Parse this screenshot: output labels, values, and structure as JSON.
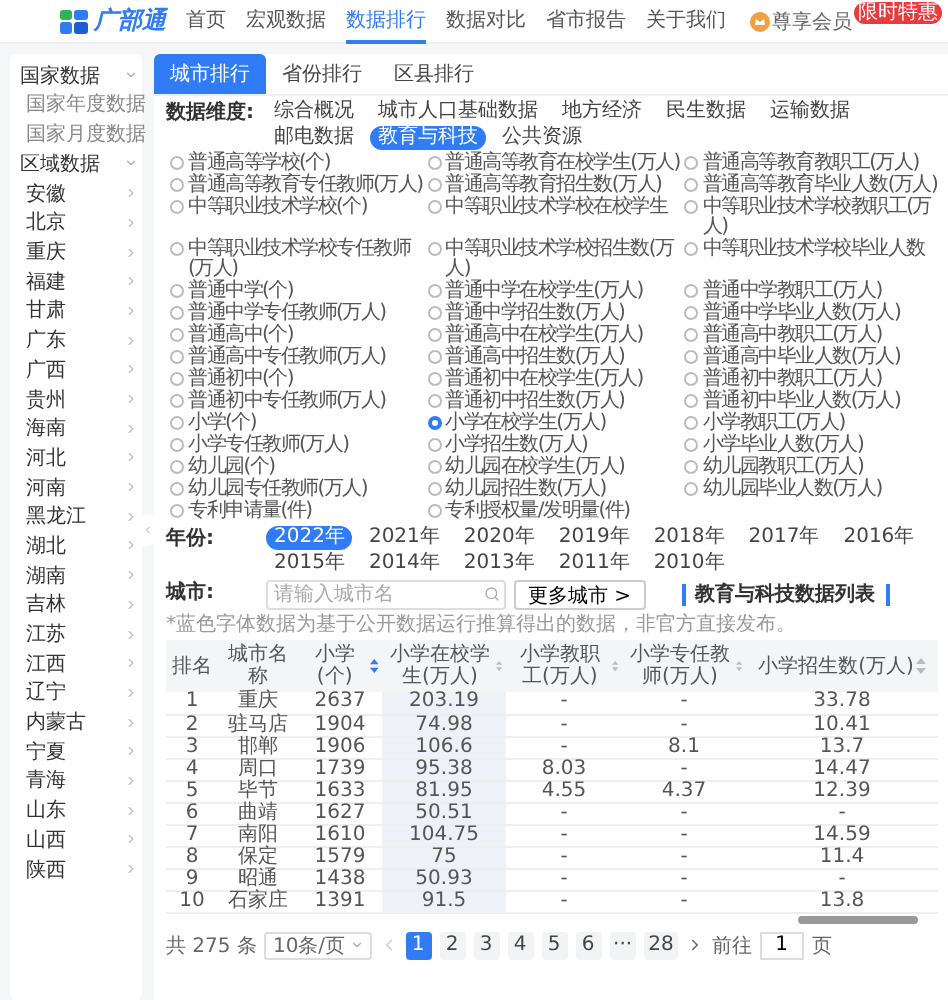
{
  "header": {
    "logo": "广部通",
    "nav": [
      {
        "label": "首页",
        "selected": false
      },
      {
        "label": "宏观数据",
        "selected": false
      },
      {
        "label": "数据排行",
        "selected": true
      },
      {
        "label": "数据对比",
        "selected": false
      },
      {
        "label": "省市报告",
        "selected": false
      },
      {
        "label": "关于我们",
        "selected": false
      }
    ],
    "member": "尊享会员",
    "badge": "限时特惠"
  },
  "sidebar": [
    {
      "label": "国家数据",
      "expanded": true,
      "children": [
        {
          "label": "国家年度数据"
        },
        {
          "label": "国家月度数据"
        }
      ]
    },
    {
      "label": "区域数据",
      "expanded": true,
      "children": [
        {
          "label": "安徽",
          "expanded": false
        },
        {
          "label": "北京",
          "expanded": false
        },
        {
          "label": "重庆",
          "expanded": false
        },
        {
          "label": "福建",
          "expanded": false
        },
        {
          "label": "甘肃",
          "expanded": false
        },
        {
          "label": "广东",
          "expanded": false
        },
        {
          "label": "广西",
          "expanded": false
        },
        {
          "label": "贵州",
          "expanded": false
        },
        {
          "label": "海南",
          "expanded": false
        },
        {
          "label": "河北",
          "expanded": false
        },
        {
          "label": "河南",
          "expanded": false
        },
        {
          "label": "黑龙江",
          "expanded": false
        },
        {
          "label": "湖北",
          "expanded": false
        },
        {
          "label": "湖南",
          "expanded": false
        },
        {
          "label": "吉林",
          "expanded": false
        },
        {
          "label": "江苏",
          "expanded": false
        },
        {
          "label": "江西",
          "expanded": false
        },
        {
          "label": "辽宁",
          "expanded": false
        },
        {
          "label": "内蒙古",
          "expanded": false
        },
        {
          "label": "宁夏",
          "expanded": false
        },
        {
          "label": "青海",
          "expanded": false
        },
        {
          "label": "山东",
          "expanded": false
        },
        {
          "label": "山西",
          "expanded": false
        },
        {
          "label": "陕西",
          "expanded": false
        }
      ]
    }
  ],
  "tabs": [
    {
      "label": "城市排行",
      "selected": true
    },
    {
      "label": "省份排行",
      "selected": false
    },
    {
      "label": "区县排行",
      "selected": false
    }
  ],
  "dimension": {
    "label": "数据维度:",
    "items": [
      {
        "label": "综合概况",
        "selected": false
      },
      {
        "label": "城市人口基础数据",
        "selected": false
      },
      {
        "label": "地方经济",
        "selected": false
      },
      {
        "label": "民生数据",
        "selected": false
      },
      {
        "label": "运输数据",
        "selected": false
      },
      {
        "label": "邮电数据",
        "selected": false
      },
      {
        "label": "教育与科技",
        "selected": true
      },
      {
        "label": "公共资源",
        "selected": false
      }
    ]
  },
  "indicators": [
    {
      "label": "普通高等学校(个)",
      "selected": false
    },
    {
      "label": "普通高等教育在校学生(万人)",
      "selected": false
    },
    {
      "label": "普通高等教育教职工(万人)",
      "selected": false
    },
    {
      "label": "普通高等教育专任教师(万人)",
      "selected": false
    },
    {
      "label": "普通高等教育招生数(万人)",
      "selected": false
    },
    {
      "label": "普通高等教育毕业人数(万人)",
      "selected": false
    },
    {
      "label": "中等职业技术学校(个)",
      "selected": false
    },
    {
      "label": "中等职业技术学校在校学生",
      "selected": false
    },
    {
      "label": "中等职业技术学校教职工(万人)",
      "selected": false
    },
    {
      "label": "中等职业技术学校专任教师(万人)",
      "selected": false
    },
    {
      "label": "中等职业技术学校招生数(万人)",
      "selected": false
    },
    {
      "label": "中等职业技术学校毕业人数",
      "selected": false
    },
    {
      "label": "普通中学(个)",
      "selected": false
    },
    {
      "label": "普通中学在校学生(万人)",
      "selected": false
    },
    {
      "label": "普通中学教职工(万人)",
      "selected": false
    },
    {
      "label": "普通中学专任教师(万人)",
      "selected": false
    },
    {
      "label": "普通中学招生数(万人)",
      "selected": false
    },
    {
      "label": "普通中学毕业人数(万人)",
      "selected": false
    },
    {
      "label": "普通高中(个)",
      "selected": false
    },
    {
      "label": "普通高中在校学生(万人)",
      "selected": false
    },
    {
      "label": "普通高中教职工(万人)",
      "selected": false
    },
    {
      "label": "普通高中专任教师(万人)",
      "selected": false
    },
    {
      "label": "普通高中招生数(万人)",
      "selected": false
    },
    {
      "label": "普通高中毕业人数(万人)",
      "selected": false
    },
    {
      "label": "普通初中(个)",
      "selected": false
    },
    {
      "label": "普通初中在校学生(万人)",
      "selected": false
    },
    {
      "label": "普通初中教职工(万人)",
      "selected": false
    },
    {
      "label": "普通初中专任教师(万人)",
      "selected": false
    },
    {
      "label": "普通初中招生数(万人)",
      "selected": false
    },
    {
      "label": "普通初中毕业人数(万人)",
      "selected": false
    },
    {
      "label": "小学(个)",
      "selected": false
    },
    {
      "label": "小学在校学生(万人)",
      "selected": true
    },
    {
      "label": "小学教职工(万人)",
      "selected": false
    },
    {
      "label": "小学专任教师(万人)",
      "selected": false
    },
    {
      "label": "小学招生数(万人)",
      "selected": false
    },
    {
      "label": "小学毕业人数(万人)",
      "selected": false
    },
    {
      "label": "幼儿园(个)",
      "selected": false
    },
    {
      "label": "幼儿园在校学生(万人)",
      "selected": false
    },
    {
      "label": "幼儿园教职工(万人)",
      "selected": false
    },
    {
      "label": "幼儿园专任教师(万人)",
      "selected": false
    },
    {
      "label": "幼儿园招生数(万人)",
      "selected": false
    },
    {
      "label": "幼儿园毕业人数(万人)",
      "selected": false
    },
    {
      "label": "专利申请量(件)",
      "selected": false
    },
    {
      "label": "专利授权量/发明量(件)",
      "selected": false
    }
  ],
  "year": {
    "label": "年份:",
    "items": [
      {
        "label": "2022年",
        "selected": true
      },
      {
        "label": "2021年",
        "selected": false
      },
      {
        "label": "2020年",
        "selected": false
      },
      {
        "label": "2019年",
        "selected": false
      },
      {
        "label": "2018年",
        "selected": false
      },
      {
        "label": "2017年",
        "selected": false
      },
      {
        "label": "2016年",
        "selected": false
      },
      {
        "label": "2015年",
        "selected": false
      },
      {
        "label": "2014年",
        "selected": false
      },
      {
        "label": "2013年",
        "selected": false
      },
      {
        "label": "2011年",
        "selected": false
      },
      {
        "label": "2010年",
        "selected": false
      }
    ]
  },
  "city": {
    "label": "城市:",
    "placeholder": "请输入城市名",
    "button": "更多城市 >"
  },
  "table": {
    "title": "教育与科技数据列表",
    "note": "*蓝色字体数据为基于公开数据运行推算得出的数据，非官方直接发布。",
    "columns": [
      {
        "label": "排名",
        "sortable": false,
        "highlighted": false
      },
      {
        "label": "城市名称",
        "sortable": false,
        "highlighted": false
      },
      {
        "label": "小学(个)",
        "sortable": true,
        "sorted": true,
        "highlighted": false
      },
      {
        "label": "小学在校学生(万人)",
        "sortable": true,
        "sorted": false,
        "highlighted": true
      },
      {
        "label": "小学教职工(万人)",
        "sortable": true,
        "sorted": false,
        "highlighted": false
      },
      {
        "label": "小学专任教师(万人)",
        "sortable": true,
        "sorted": false,
        "highlighted": false
      },
      {
        "label": "小学招生数(万人)",
        "sortable": true,
        "sorted": false,
        "highlighted": false
      }
    ],
    "rows": [
      [
        "1",
        "重庆",
        "2637",
        "203.19",
        "-",
        "-",
        "33.78"
      ],
      [
        "2",
        "驻马店",
        "1904",
        "74.98",
        "-",
        "-",
        "10.41"
      ],
      [
        "3",
        "邯郸",
        "1906",
        "106.6",
        "-",
        "8.1",
        "13.7"
      ],
      [
        "4",
        "周口",
        "1739",
        "95.38",
        "8.03",
        "-",
        "14.47"
      ],
      [
        "5",
        "毕节",
        "1633",
        "81.95",
        "4.55",
        "4.37",
        "12.39"
      ],
      [
        "6",
        "曲靖",
        "1627",
        "50.51",
        "-",
        "-",
        "-"
      ],
      [
        "7",
        "南阳",
        "1610",
        "104.75",
        "-",
        "-",
        "14.59"
      ],
      [
        "8",
        "保定",
        "1579",
        "75",
        "-",
        "-",
        "11.4"
      ],
      [
        "9",
        "昭通",
        "1438",
        "50.93",
        "-",
        "-",
        "-"
      ],
      [
        "10",
        "石家庄",
        "1391",
        "91.5",
        "-",
        "-",
        "13.8"
      ]
    ]
  },
  "pagination": {
    "total": "共 275 条",
    "page_size": "10条/页",
    "pages": [
      {
        "label": "1",
        "selected": true
      },
      {
        "label": "2",
        "selected": false
      },
      {
        "label": "3",
        "selected": false
      },
      {
        "label": "4",
        "selected": false
      },
      {
        "label": "5",
        "selected": false
      },
      {
        "label": "6",
        "selected": false
      },
      {
        "label": "···",
        "selected": false
      },
      {
        "label": "28",
        "selected": false
      }
    ],
    "goto": "前往",
    "goto_value": "1",
    "unit": "页"
  }
}
